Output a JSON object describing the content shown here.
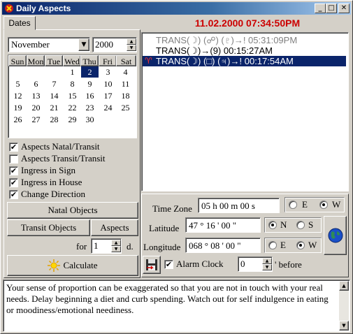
{
  "window": {
    "title": "Daily Aspects",
    "datetime": "11.02.2000  07:34:50PM",
    "accent": "#cc0000"
  },
  "tabs": {
    "dates": "Dates"
  },
  "calendar": {
    "month": "November",
    "year": "2000",
    "weekdays": [
      "Sun",
      "Mon",
      "Tue",
      "Wed",
      "Thu",
      "Fri",
      "Sat"
    ],
    "weeks": [
      [
        "",
        "",
        "",
        "1",
        "2",
        "3",
        "4"
      ],
      [
        "5",
        "6",
        "7",
        "8",
        "9",
        "10",
        "11"
      ],
      [
        "12",
        "13",
        "14",
        "15",
        "16",
        "17",
        "18"
      ],
      [
        "19",
        "20",
        "21",
        "22",
        "23",
        "24",
        "25"
      ],
      [
        "26",
        "27",
        "28",
        "29",
        "30",
        "",
        ""
      ]
    ],
    "selected_day": "2"
  },
  "options": {
    "aspects_natal_transit": {
      "label": "Aspects Natal/Transit",
      "checked": "✔"
    },
    "aspects_transit_transit": {
      "label": "Aspects Transit/Transit",
      "checked": ""
    },
    "ingress_in_sign": {
      "label": "Ingress in Sign",
      "checked": "✔"
    },
    "ingress_in_house": {
      "label": "Ingress in House",
      "checked": "✔"
    },
    "change_direction": {
      "label": "Change Direction",
      "checked": "✔"
    }
  },
  "buttons": {
    "natal_objects": "Natal Objects",
    "transit_objects": "Transit Objects",
    "aspects": "Aspects",
    "for_label": "for",
    "for_value": "1",
    "for_unit": "d.",
    "calculate": "Calculate"
  },
  "events": [
    {
      "text": "TRANS(☽) (☍) (♇)→! 05:31:09PM",
      "state": "past"
    },
    {
      "text": "TRANS(☽)→(9) 00:15:27AM",
      "state": "normal"
    },
    {
      "text": "TRANS(☽) (□) (♃)→! 00:17:54AM",
      "state": "selected",
      "marker": "♈"
    }
  ],
  "location": {
    "timezone_label": "Time Zone",
    "timezone_value": "05  h 00 m  00 s",
    "tz_e": "E",
    "tz_w": "W",
    "latitude_label": "Latitude",
    "latitude_value": "47  ° 16 ' 00 \"",
    "lat_n": "N",
    "lat_s": "S",
    "longitude_label": "Longitude",
    "longitude_value": "068  ° 08 ' 00 \"",
    "lon_e": "E",
    "lon_w": "W"
  },
  "alarm": {
    "label": "Alarm Clock",
    "checked": "✔",
    "value": "0",
    "suffix": "' before"
  },
  "description": "Your sense of proportion can be exaggerated so that you are not in touch with your real needs.  Delay beginning a diet and curb spending.  Watch out for self indulgence in eating or moodiness/emotional neediness."
}
